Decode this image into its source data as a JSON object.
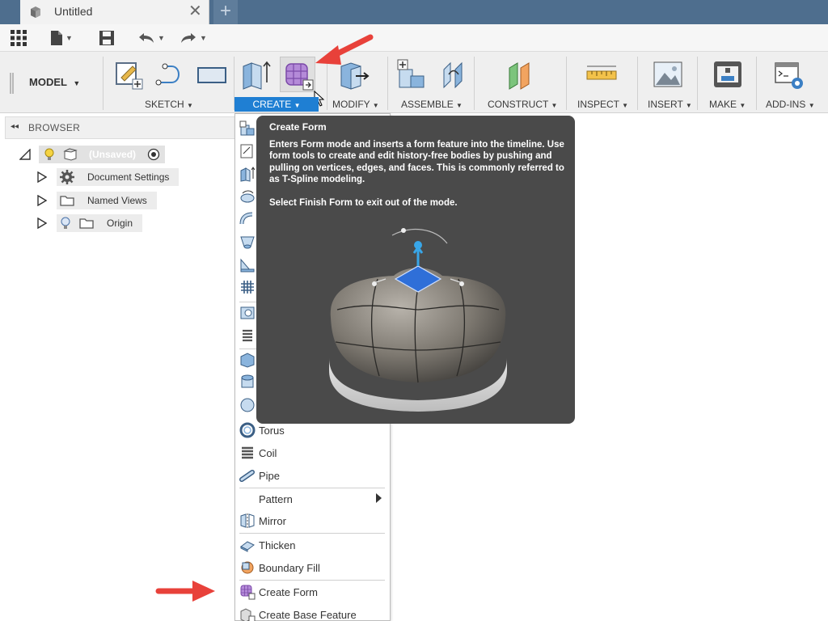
{
  "tab": {
    "title": "Untitled",
    "close": "✕",
    "new": "+"
  },
  "ribbon": {
    "workspace": "MODEL",
    "groups": [
      {
        "label": "SKETCH"
      },
      {
        "label": "CREATE"
      },
      {
        "label": "MODIFY"
      },
      {
        "label": "ASSEMBLE"
      },
      {
        "label": "CONSTRUCT"
      },
      {
        "label": "INSPECT"
      },
      {
        "label": "INSERT"
      },
      {
        "label": "MAKE"
      },
      {
        "label": "ADD-INS"
      }
    ],
    "caret": "▼"
  },
  "browser": {
    "title": "BROWSER",
    "collapse": "◂◂",
    "items": [
      {
        "label": "(Unsaved)"
      },
      {
        "label": "Document Settings"
      },
      {
        "label": "Named Views"
      },
      {
        "label": "Origin"
      }
    ]
  },
  "menu": {
    "items": [
      {
        "label": "Torus",
        "icon": "torus-icon"
      },
      {
        "label": "Coil",
        "icon": "coil-icon"
      },
      {
        "label": "Pipe",
        "icon": "pipe-icon"
      },
      {
        "label": "Pattern",
        "icon": ""
      },
      {
        "label": "Mirror",
        "icon": "mirror-icon"
      },
      {
        "label": "Thicken",
        "icon": "thicken-icon"
      },
      {
        "label": "Boundary Fill",
        "icon": "boundary-fill-icon"
      },
      {
        "label": "Create Form",
        "icon": "create-form-icon"
      },
      {
        "label": "Create Base Feature",
        "icon": "create-base-feature-icon"
      }
    ]
  },
  "tooltip": {
    "title": "Create Form",
    "body": "Enters Form mode and inserts a form feature into the timeline. Use form tools to create and edit history-free bodies by pushing and pulling on vertices, edges, and faces. This is commonly referred to as T-Spline modeling.",
    "note": "Select Finish Form to exit out of the mode."
  },
  "colors": {
    "accent": "#1f7fd3",
    "annotation_arrow": "#e8413a",
    "tooltip_bg": "#4a4a4a",
    "titlebar": "#4e6e8e"
  }
}
